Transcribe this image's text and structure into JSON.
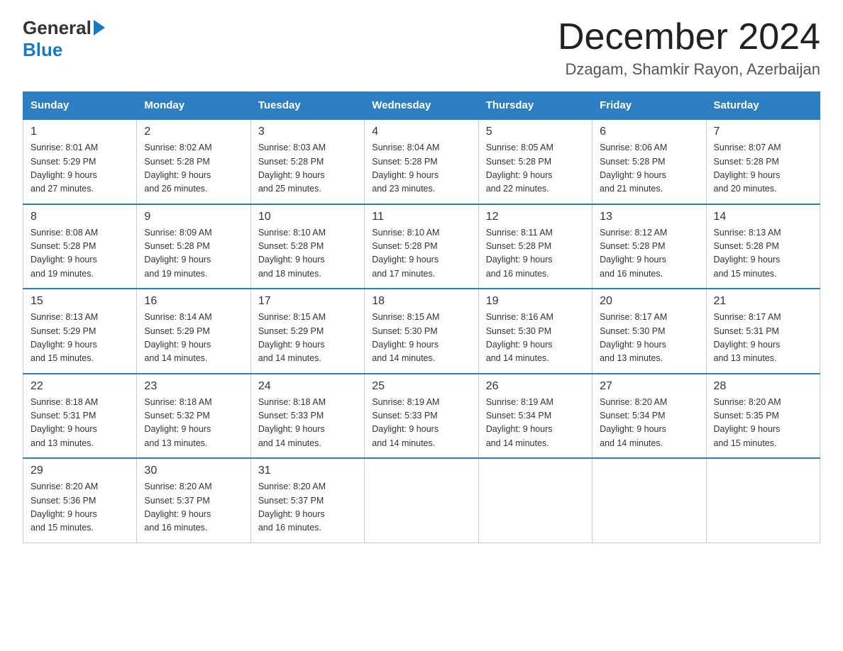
{
  "logo": {
    "line1": "General",
    "arrow": "▶",
    "line2": "Blue"
  },
  "title": "December 2024",
  "location": "Dzagam, Shamkir Rayon, Azerbaijan",
  "days_of_week": [
    "Sunday",
    "Monday",
    "Tuesday",
    "Wednesday",
    "Thursday",
    "Friday",
    "Saturday"
  ],
  "weeks": [
    [
      {
        "day": 1,
        "sunrise": "8:01 AM",
        "sunset": "5:29 PM",
        "daylight": "9 hours and 27 minutes."
      },
      {
        "day": 2,
        "sunrise": "8:02 AM",
        "sunset": "5:28 PM",
        "daylight": "9 hours and 26 minutes."
      },
      {
        "day": 3,
        "sunrise": "8:03 AM",
        "sunset": "5:28 PM",
        "daylight": "9 hours and 25 minutes."
      },
      {
        "day": 4,
        "sunrise": "8:04 AM",
        "sunset": "5:28 PM",
        "daylight": "9 hours and 23 minutes."
      },
      {
        "day": 5,
        "sunrise": "8:05 AM",
        "sunset": "5:28 PM",
        "daylight": "9 hours and 22 minutes."
      },
      {
        "day": 6,
        "sunrise": "8:06 AM",
        "sunset": "5:28 PM",
        "daylight": "9 hours and 21 minutes."
      },
      {
        "day": 7,
        "sunrise": "8:07 AM",
        "sunset": "5:28 PM",
        "daylight": "9 hours and 20 minutes."
      }
    ],
    [
      {
        "day": 8,
        "sunrise": "8:08 AM",
        "sunset": "5:28 PM",
        "daylight": "9 hours and 19 minutes."
      },
      {
        "day": 9,
        "sunrise": "8:09 AM",
        "sunset": "5:28 PM",
        "daylight": "9 hours and 19 minutes."
      },
      {
        "day": 10,
        "sunrise": "8:10 AM",
        "sunset": "5:28 PM",
        "daylight": "9 hours and 18 minutes."
      },
      {
        "day": 11,
        "sunrise": "8:10 AM",
        "sunset": "5:28 PM",
        "daylight": "9 hours and 17 minutes."
      },
      {
        "day": 12,
        "sunrise": "8:11 AM",
        "sunset": "5:28 PM",
        "daylight": "9 hours and 16 minutes."
      },
      {
        "day": 13,
        "sunrise": "8:12 AM",
        "sunset": "5:28 PM",
        "daylight": "9 hours and 16 minutes."
      },
      {
        "day": 14,
        "sunrise": "8:13 AM",
        "sunset": "5:28 PM",
        "daylight": "9 hours and 15 minutes."
      }
    ],
    [
      {
        "day": 15,
        "sunrise": "8:13 AM",
        "sunset": "5:29 PM",
        "daylight": "9 hours and 15 minutes."
      },
      {
        "day": 16,
        "sunrise": "8:14 AM",
        "sunset": "5:29 PM",
        "daylight": "9 hours and 14 minutes."
      },
      {
        "day": 17,
        "sunrise": "8:15 AM",
        "sunset": "5:29 PM",
        "daylight": "9 hours and 14 minutes."
      },
      {
        "day": 18,
        "sunrise": "8:15 AM",
        "sunset": "5:30 PM",
        "daylight": "9 hours and 14 minutes."
      },
      {
        "day": 19,
        "sunrise": "8:16 AM",
        "sunset": "5:30 PM",
        "daylight": "9 hours and 14 minutes."
      },
      {
        "day": 20,
        "sunrise": "8:17 AM",
        "sunset": "5:30 PM",
        "daylight": "9 hours and 13 minutes."
      },
      {
        "day": 21,
        "sunrise": "8:17 AM",
        "sunset": "5:31 PM",
        "daylight": "9 hours and 13 minutes."
      }
    ],
    [
      {
        "day": 22,
        "sunrise": "8:18 AM",
        "sunset": "5:31 PM",
        "daylight": "9 hours and 13 minutes."
      },
      {
        "day": 23,
        "sunrise": "8:18 AM",
        "sunset": "5:32 PM",
        "daylight": "9 hours and 13 minutes."
      },
      {
        "day": 24,
        "sunrise": "8:18 AM",
        "sunset": "5:33 PM",
        "daylight": "9 hours and 14 minutes."
      },
      {
        "day": 25,
        "sunrise": "8:19 AM",
        "sunset": "5:33 PM",
        "daylight": "9 hours and 14 minutes."
      },
      {
        "day": 26,
        "sunrise": "8:19 AM",
        "sunset": "5:34 PM",
        "daylight": "9 hours and 14 minutes."
      },
      {
        "day": 27,
        "sunrise": "8:20 AM",
        "sunset": "5:34 PM",
        "daylight": "9 hours and 14 minutes."
      },
      {
        "day": 28,
        "sunrise": "8:20 AM",
        "sunset": "5:35 PM",
        "daylight": "9 hours and 15 minutes."
      }
    ],
    [
      {
        "day": 29,
        "sunrise": "8:20 AM",
        "sunset": "5:36 PM",
        "daylight": "9 hours and 15 minutes."
      },
      {
        "day": 30,
        "sunrise": "8:20 AM",
        "sunset": "5:37 PM",
        "daylight": "9 hours and 16 minutes."
      },
      {
        "day": 31,
        "sunrise": "8:20 AM",
        "sunset": "5:37 PM",
        "daylight": "9 hours and 16 minutes."
      },
      null,
      null,
      null,
      null
    ]
  ],
  "labels": {
    "sunrise": "Sunrise:",
    "sunset": "Sunset:",
    "daylight": "Daylight:"
  }
}
